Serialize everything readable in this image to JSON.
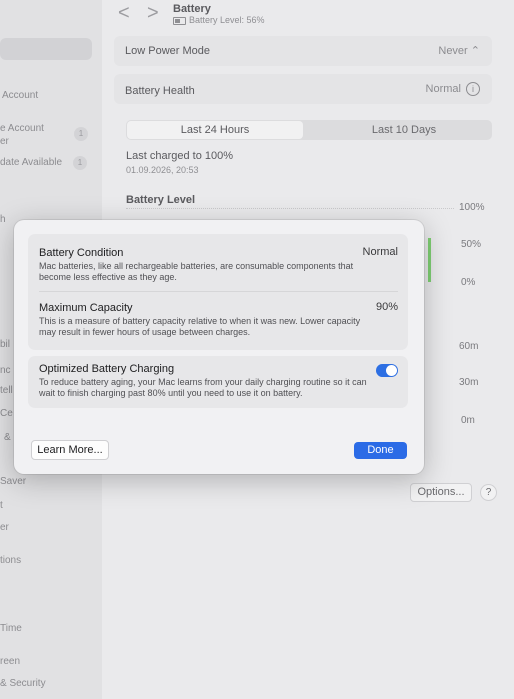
{
  "sidebar": {
    "items": [
      {
        "label": "Account"
      },
      {
        "label": "e Account"
      },
      {
        "label": "er"
      },
      {
        "label": "date Available"
      },
      {
        "label": "h"
      },
      {
        "label": "bil"
      },
      {
        "label": "nc"
      },
      {
        "label": "tell"
      },
      {
        "label": "Ce"
      },
      {
        "label": "&"
      },
      {
        "label": "Saver"
      },
      {
        "label": "t"
      },
      {
        "label": "er"
      },
      {
        "label": "tions"
      },
      {
        "label": "Time"
      },
      {
        "label": "reen"
      },
      {
        "label": "& Security"
      }
    ],
    "badges": [
      "1",
      "1"
    ]
  },
  "header": {
    "back_icon": "<",
    "forward_icon": ">",
    "title": "Battery",
    "subtitle": "Battery Level: 56%"
  },
  "settings": {
    "low_power_label": "Low Power Mode",
    "low_power_value": "Never",
    "health_label": "Battery Health",
    "health_value": "Normal",
    "tabs": [
      "Last 24 Hours",
      "Last 10 Days"
    ],
    "last_charged": "Last charged to 100%",
    "last_charged_time": "01.09.2026, 20:53",
    "battery_level_title": "Battery Level",
    "axis_level": [
      "100%",
      "50%",
      "0%"
    ],
    "axis_usage": [
      "60m",
      "30m",
      "0m"
    ],
    "options_label": "Options...",
    "help_label": "?"
  },
  "modal": {
    "condition_title": "Battery Condition",
    "condition_value": "Normal",
    "condition_desc": "Mac batteries, like all rechargeable batteries, are consumable components that become less effective as they age.",
    "capacity_title": "Maximum Capacity",
    "capacity_value": "90%",
    "capacity_desc": "This is a measure of battery capacity relative to when it was new. Lower capacity may result in fewer hours of usage between charges.",
    "optimized_title": "Optimized Battery Charging",
    "optimized_desc": "To reduce battery aging, your Mac learns from your daily charging routine so it can wait to finish charging past 80% until you need to use it on battery.",
    "optimized_on": true,
    "learn_more": "Learn More...",
    "done": "Done"
  },
  "colors": {
    "accent": "#2b6be6",
    "battery_green": "#7fcf73"
  }
}
